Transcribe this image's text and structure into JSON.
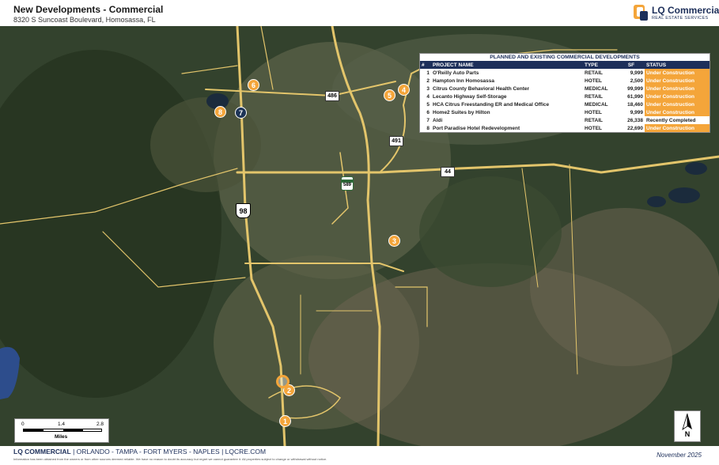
{
  "header": {
    "title": "New Developments - Commercial",
    "subtitle": "8320 S Suncoast Boulevard, Homosassa, FL"
  },
  "logo": {
    "name": "LQ Commercial",
    "tagline": "REAL ESTATE SERVICES"
  },
  "table": {
    "title": "PLANNED AND EXISTING COMMERCIAL DEVELOPMENTS",
    "columns": [
      "#",
      "PROJECT NAME",
      "TYPE",
      "SF",
      "STATUS"
    ],
    "rows": [
      {
        "num": "1",
        "name": "O'Reilly Auto Parts",
        "type": "RETAIL",
        "sf": "9,999",
        "status": "Under Construction"
      },
      {
        "num": "2",
        "name": "Hampton Inn Homosassa",
        "type": "HOTEL",
        "sf": "2,500",
        "status": "Under Construction"
      },
      {
        "num": "3",
        "name": "Citrus County Behavioral Health Center",
        "type": "MEDICAL",
        "sf": "99,999",
        "status": "Under Construction"
      },
      {
        "num": "4",
        "name": "Lecanto Highway Self-Storage",
        "type": "RETAIL",
        "sf": "61,990",
        "status": "Under Construction"
      },
      {
        "num": "5",
        "name": "HCA Citrus Freestanding ER and Medical Office",
        "type": "MEDICAL",
        "sf": "18,460",
        "status": "Under Construction"
      },
      {
        "num": "6",
        "name": "Home2 Suites by Hilton",
        "type": "HOTEL",
        "sf": "9,999",
        "status": "Under Construction"
      },
      {
        "num": "7",
        "name": "Aldi",
        "type": "RETAIL",
        "sf": "26,338",
        "status": "Recently Completed"
      },
      {
        "num": "8",
        "name": "Port Paradise Hotel Redevelopment",
        "type": "HOTEL",
        "sf": "22,690",
        "status": "Under Construction"
      }
    ]
  },
  "markers": [
    {
      "num": "1",
      "style": "orange"
    },
    {
      "num": "2",
      "style": "orange"
    },
    {
      "num": "3",
      "style": "orange"
    },
    {
      "num": "4",
      "style": "orange"
    },
    {
      "num": "5",
      "style": "orange"
    },
    {
      "num": "6",
      "style": "orange"
    },
    {
      "num": "7",
      "style": "dark"
    },
    {
      "num": "8",
      "style": "orange"
    }
  ],
  "road_shields": [
    {
      "label": "98",
      "kind": "us"
    },
    {
      "label": "44",
      "kind": "sr"
    },
    {
      "label": "486",
      "kind": "sr"
    },
    {
      "label": "491",
      "kind": "sr"
    },
    {
      "label": "589",
      "kind": "state"
    }
  ],
  "scale": {
    "ticks": [
      "0",
      "1.4",
      "2.8"
    ],
    "units": "Miles"
  },
  "north_label": "N",
  "footer": {
    "company": "LQ COMMERCIAL",
    "locations": " | ORLANDO - TAMPA - FORT MYERS - NAPLES | LQCRE.COM",
    "disclaimer": "Information has been obtained from the owners or from other sources deemed reliable. We have no reason to doubt its accuracy but regret we cannot guarantee it. All properties subject to change or withdrawal without notice.",
    "date": "November 2025"
  },
  "colors": {
    "accent_orange": "#f4a53a",
    "navy": "#1d2f5a",
    "road": "#e3c56b"
  }
}
